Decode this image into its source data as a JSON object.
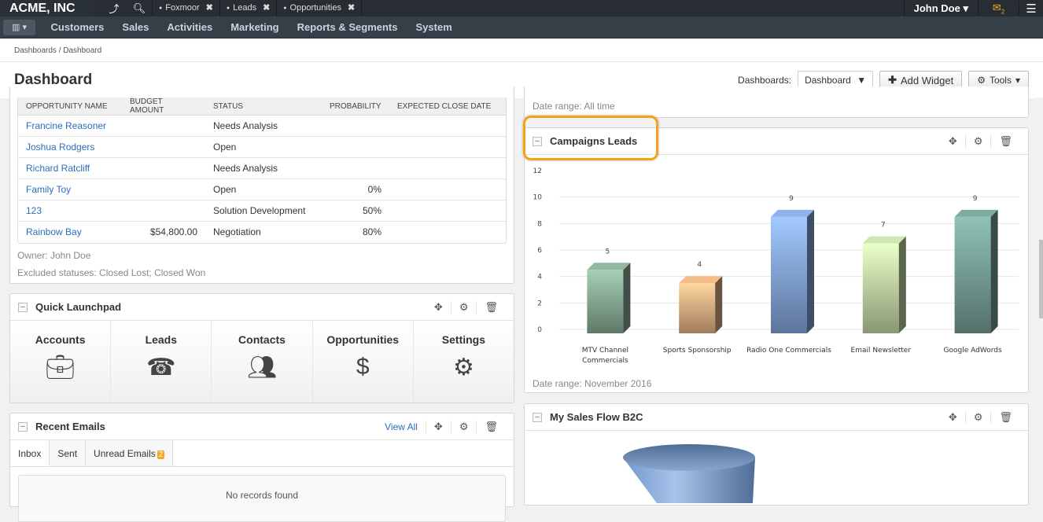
{
  "topbar": {
    "brand": "ACME, INC",
    "icons": [
      "share-icon",
      "search-icon"
    ],
    "tabs": [
      {
        "label": "Foxmoor"
      },
      {
        "label": "Leads"
      },
      {
        "label": "Opportunities"
      }
    ],
    "user": "John Doe",
    "mail_count": "2"
  },
  "nav": {
    "items": [
      "Customers",
      "Sales",
      "Activities",
      "Marketing",
      "Reports & Segments",
      "System"
    ]
  },
  "breadcrumb": "Dashboards / Dashboard",
  "header": {
    "title": "Dashboard",
    "dashboards_label": "Dashboards:",
    "dashboard_select": "Dashboard",
    "add_widget": "Add Widget",
    "tools": "Tools"
  },
  "opportunities": {
    "columns": [
      "OPPORTUNITY NAME",
      "BUDGET AMOUNT",
      "STATUS",
      "PROBABILITY",
      "EXPECTED CLOSE DATE"
    ],
    "rows": [
      {
        "name": "Francine Reasoner",
        "budget": "",
        "status": "Needs Analysis",
        "probability": "",
        "close": ""
      },
      {
        "name": "Joshua Rodgers",
        "budget": "",
        "status": "Open",
        "probability": "",
        "close": ""
      },
      {
        "name": "Richard Ratcliff",
        "budget": "",
        "status": "Needs Analysis",
        "probability": "",
        "close": ""
      },
      {
        "name": "Family Toy",
        "budget": "",
        "status": "Open",
        "probability": "0%",
        "close": ""
      },
      {
        "name": "123",
        "budget": "",
        "status": "Solution Development",
        "probability": "50%",
        "close": ""
      },
      {
        "name": "Rainbow Bay",
        "budget": "$54,800.00",
        "status": "Negotiation",
        "probability": "80%",
        "close": ""
      }
    ],
    "owner": "Owner: John Doe",
    "excluded": "Excluded statuses: Closed Lost; Closed Won"
  },
  "launchpad": {
    "title": "Quick Launchpad",
    "items": [
      {
        "label": "Accounts",
        "icon": "briefcase-icon"
      },
      {
        "label": "Leads",
        "icon": "phone-icon"
      },
      {
        "label": "Contacts",
        "icon": "users-icon"
      },
      {
        "label": "Opportunities",
        "icon": "dollar-icon"
      },
      {
        "label": "Settings",
        "icon": "cogs-icon"
      }
    ]
  },
  "emails": {
    "title": "Recent Emails",
    "view_all": "View All",
    "tabs": [
      "Inbox",
      "Sent",
      "Unread Emails"
    ],
    "unread_count": "2",
    "empty": "No records found"
  },
  "top_right_panel": {
    "date_range": "Date range: All time"
  },
  "campaigns": {
    "title": "Campaigns Leads",
    "date_range": "Date range: November 2016"
  },
  "salesflow": {
    "title": "My Sales Flow B2C"
  },
  "chart_data": {
    "type": "bar",
    "title": "Campaigns Leads",
    "categories": [
      "MTV Channel Commercials",
      "Sports Sponsorship",
      "Radio One Commercials",
      "Email Newsletter",
      "Google AdWords"
    ],
    "category_lines": [
      [
        "MTV Channel",
        "Commercials"
      ],
      [
        "Sports Sponsorship"
      ],
      [
        "Radio One Commercials"
      ],
      [
        "Email Newsletter"
      ],
      [
        "Google AdWords"
      ]
    ],
    "values": [
      5,
      4,
      9,
      7,
      9
    ],
    "colors": [
      "#7fa08c",
      "#d4a57a",
      "#7c9bcd",
      "#b5c99a",
      "#6f958c"
    ],
    "ylim": [
      0,
      12
    ],
    "yticks": [
      0,
      2,
      4,
      6,
      8,
      10,
      12
    ],
    "grid": true,
    "xlabel": "",
    "ylabel": ""
  }
}
